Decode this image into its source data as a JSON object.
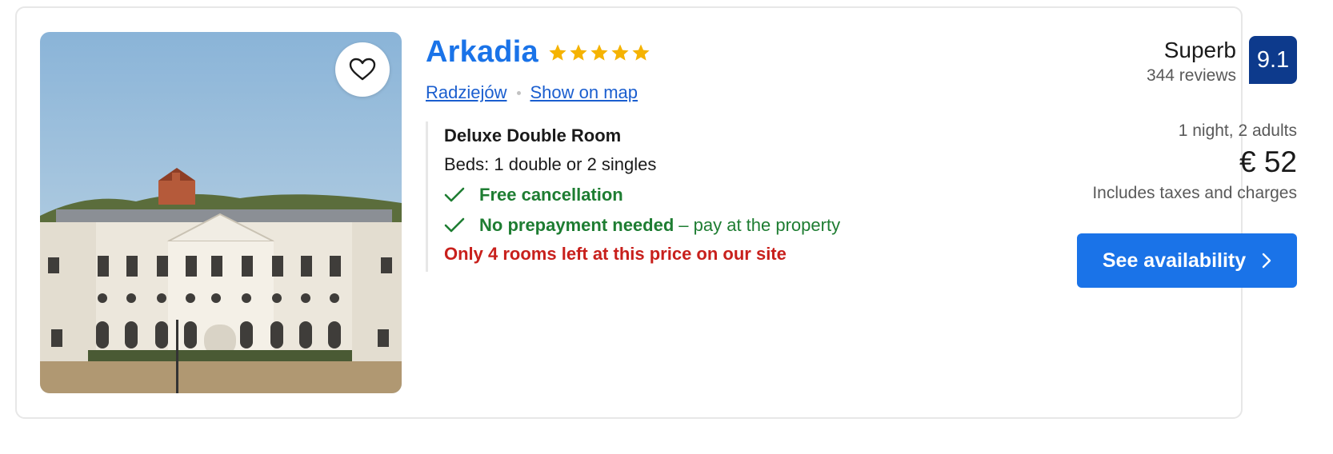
{
  "hotel": {
    "name": "Arkadia",
    "star_count": 5,
    "star_color": "#f5b301",
    "location_link": "Radziejów",
    "map_link": "Show on map",
    "favorite_icon": "heart-outline-icon"
  },
  "room": {
    "name": "Deluxe Double Room",
    "beds": "Beds: 1 double or 2 singles",
    "perks": [
      {
        "icon": "checkmark-icon",
        "label": "Free cancellation",
        "suffix": ""
      },
      {
        "icon": "checkmark-icon",
        "label": "No prepayment needed",
        "suffix": "– pay at the property"
      }
    ],
    "scarcity": "Only 4 rooms left at this price on our site"
  },
  "rating": {
    "word": "Superb",
    "reviews": "344 reviews",
    "score": "9.1"
  },
  "pricing": {
    "stay": "1 night, 2 adults",
    "price": "€ 52",
    "taxes": "Includes taxes and charges",
    "cta_label": "See availability"
  },
  "colors": {
    "link": "#1a73e8",
    "positive": "#1e7d32",
    "urgent": "#c8201c",
    "score_bg": "#0d3a8c"
  }
}
